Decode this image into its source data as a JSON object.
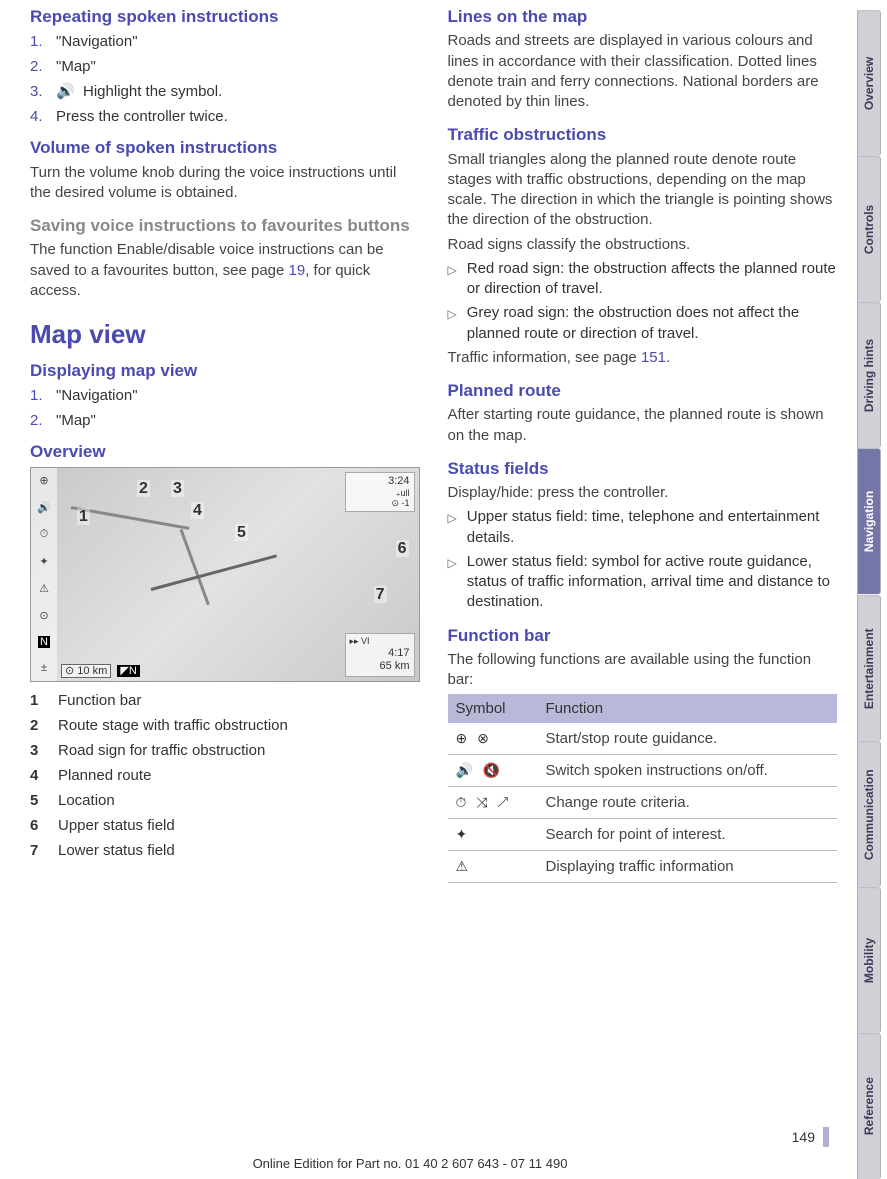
{
  "sidebar": {
    "tabs": [
      "Overview",
      "Controls",
      "Driving hints",
      "Navigation",
      "Entertainment",
      "Communication",
      "Mobility",
      "Reference"
    ],
    "active_index": 3
  },
  "left": {
    "h_repeat": "Repeating spoken instructions",
    "repeat_steps": [
      {
        "n": "1.",
        "t": "\"Navigation\""
      },
      {
        "n": "2.",
        "t": "\"Map\""
      },
      {
        "n": "3.",
        "t": "Highlight the symbol.",
        "has_icon": true
      },
      {
        "n": "4.",
        "t": "Press the controller twice."
      }
    ],
    "h_volume": "Volume of spoken instructions",
    "p_volume": "Turn the volume knob during the voice instructions until the desired volume is obtained.",
    "h_saving": "Saving voice instructions to favourites buttons",
    "p_saving_a": "The function Enable/disable voice instructions can be saved to a favourites button, see page ",
    "p_saving_link": "19",
    "p_saving_b": ", for quick access.",
    "h_mapview": "Map view",
    "h_display": "Displaying map view",
    "display_steps": [
      {
        "n": "1.",
        "t": "\"Navigation\""
      },
      {
        "n": "2.",
        "t": "\"Map\""
      }
    ],
    "h_overview": "Overview",
    "map": {
      "upper_time": "3:24",
      "upper_sig": "₊ull",
      "upper_sub": "⊙ -1",
      "lower_sym": "▸▸  VI",
      "lower_time": "4:17",
      "lower_dist": "65 km",
      "scale": "10 km",
      "scale_n": "N"
    },
    "legend": [
      {
        "n": "1",
        "t": "Function bar"
      },
      {
        "n": "2",
        "t": "Route stage with traffic obstruction"
      },
      {
        "n": "3",
        "t": "Road sign for traffic obstruction"
      },
      {
        "n": "4",
        "t": "Planned route"
      },
      {
        "n": "5",
        "t": "Location"
      },
      {
        "n": "6",
        "t": "Upper status field"
      },
      {
        "n": "7",
        "t": "Lower status field"
      }
    ]
  },
  "right": {
    "h_lines": "Lines on the map",
    "p_lines": "Roads and streets are displayed in various colours and lines in accordance with their classification. Dotted lines denote train and ferry connections. National borders are denoted by thin lines.",
    "h_traffic": "Traffic obstructions",
    "p_traffic1": "Small triangles along the planned route denote route stages with traffic obstructions, depending on the map scale. The direction in which the triangle is pointing shows the direction of the obstruction.",
    "p_traffic2": "Road signs classify the obstructions.",
    "traffic_items": [
      "Red road sign: the obstruction affects the planned route or direction of travel.",
      "Grey road sign: the obstruction does not affect the planned route or direction of travel."
    ],
    "p_traffic3a": "Traffic information, see page ",
    "p_traffic3_link": "151",
    "p_traffic3b": ".",
    "h_planned": "Planned route",
    "p_planned": "After starting route guidance, the planned route is shown on the map.",
    "h_status": "Status fields",
    "p_status1": "Display/hide: press the controller.",
    "status_items": [
      "Upper status field: time, telephone and entertainment details.",
      "Lower status field: symbol for active route guidance, status of traffic information, arrival time and distance to destination."
    ],
    "h_funcbar": "Function bar",
    "p_funcbar": "The following functions are available using the function bar:",
    "table": {
      "h1": "Symbol",
      "h2": "Function",
      "rows": [
        {
          "sym": "⊕  ⊗",
          "fn": "Start/stop route guidance."
        },
        {
          "sym": "🔊  🔇",
          "fn": "Switch spoken instructions on/off."
        },
        {
          "sym": "⏱  ⤨  ↗",
          "fn": "Change route criteria."
        },
        {
          "sym": "✦",
          "fn": "Search for point of interest."
        },
        {
          "sym": "⚠",
          "fn": "Displaying traffic information"
        }
      ]
    }
  },
  "footer": {
    "page": "149",
    "line": "Online Edition for Part no. 01 40 2 607 643 - 07 11 490"
  }
}
